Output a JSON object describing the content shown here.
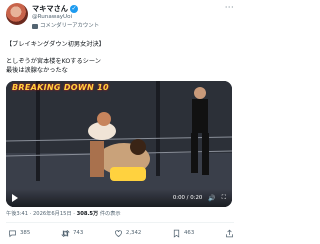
{
  "author": {
    "display_name": "マキマさん",
    "handle": "@RunawayUoi",
    "community": "コメンダリーアカウント"
  },
  "icons": {
    "verified": "verified-badge-icon",
    "more": "more-options-icon",
    "community": "community-icon",
    "reply": "reply-icon",
    "retweet": "retweet-icon",
    "like": "heart-icon",
    "bookmark": "bookmark-icon",
    "share": "share-icon"
  },
  "post": {
    "line1": "【ブレイキングダウン初男女対決】",
    "line2": "としぞうが宮本楼をKOするシーン",
    "line3": "最後は涙腺なかったな"
  },
  "video": {
    "overlay_title": "BREAKING DOWN 10",
    "time": "0:00 / 0:20",
    "play_label": "play",
    "accent": "#ffd23f"
  },
  "meta": {
    "timestamp": "午後3:41 · 2026年6月15日 · ",
    "views_count": "308.5万",
    "views_label": " 件の表示"
  },
  "actions": {
    "reply_count": "385",
    "retweet_count": "743",
    "like_count": "2,342",
    "bookmark_count": "463"
  },
  "colors": {
    "verified": "#1d9bf0",
    "muted": "#536471"
  }
}
